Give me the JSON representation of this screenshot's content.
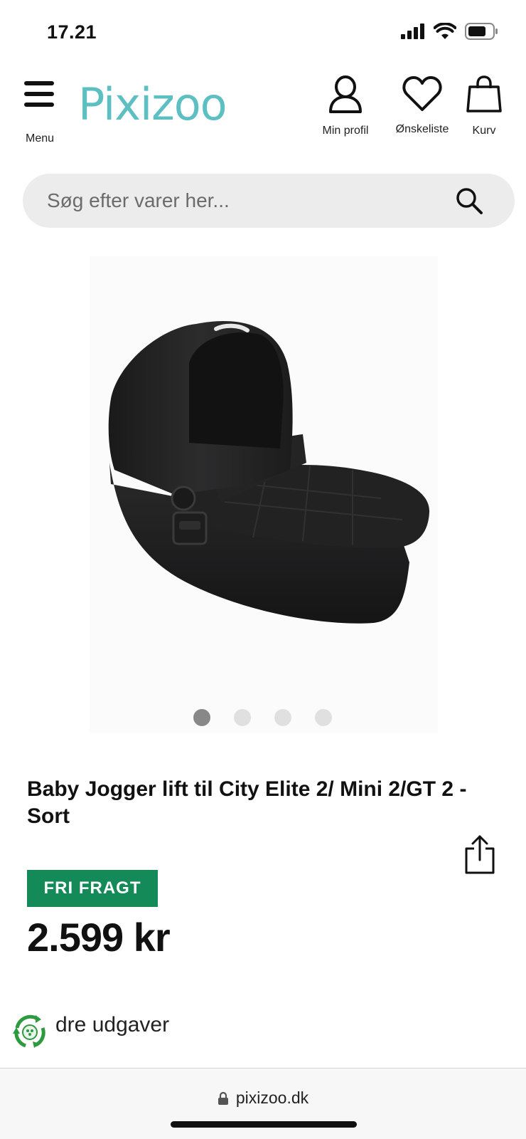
{
  "status_bar": {
    "time": "17.21",
    "icons": [
      "signal-icon",
      "wifi-icon",
      "battery-icon"
    ]
  },
  "header": {
    "menu_label": "Menu",
    "logo_text": "Pixizoo",
    "profile_label": "Min profil",
    "wishlist_label": "Ønskeliste",
    "cart_label": "Kurv"
  },
  "search": {
    "placeholder": "Søg efter varer her..."
  },
  "gallery": {
    "image_count": 4,
    "active_index": 0
  },
  "product": {
    "title": "Baby Jogger lift til City Elite 2/ Mini 2/GT 2 - Sort",
    "badge": "FRI FRAGT",
    "price": "2.599 kr",
    "other_versions": "dre udgaver"
  },
  "browser": {
    "url": "pixizoo.dk"
  },
  "colors": {
    "brand": "#5cbfc2",
    "badge": "#138a58",
    "eco": "#2e9a3f"
  }
}
